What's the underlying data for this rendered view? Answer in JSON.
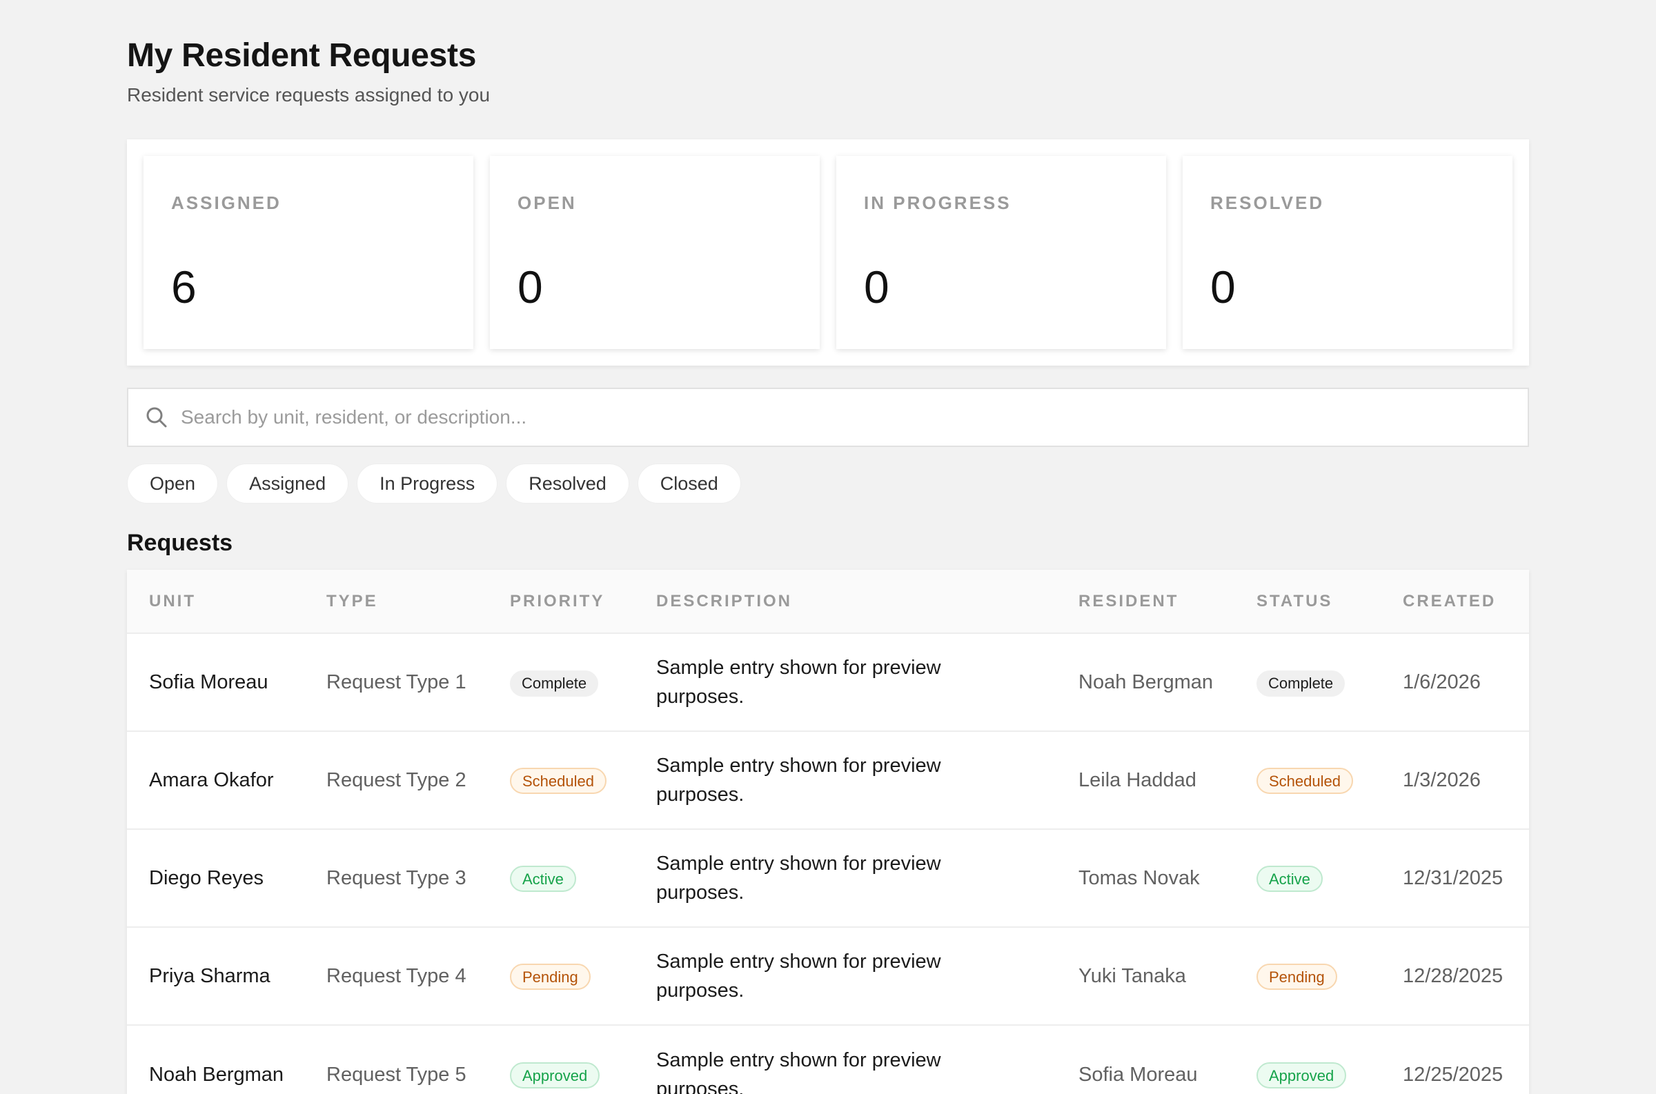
{
  "header": {
    "title": "My Resident Requests",
    "subtitle": "Resident service requests assigned to you"
  },
  "stats": [
    {
      "label": "ASSIGNED",
      "value": "6"
    },
    {
      "label": "OPEN",
      "value": "0"
    },
    {
      "label": "IN PROGRESS",
      "value": "0"
    },
    {
      "label": "RESOLVED",
      "value": "0"
    }
  ],
  "search": {
    "icon": "search-icon",
    "placeholder": "Search by unit, resident, or description...",
    "value": ""
  },
  "filters": [
    "Open",
    "Assigned",
    "In Progress",
    "Resolved",
    "Closed"
  ],
  "requests": {
    "title": "Requests",
    "columns": [
      "UNIT",
      "TYPE",
      "PRIORITY",
      "DESCRIPTION",
      "RESIDENT",
      "STATUS",
      "CREATED"
    ],
    "rows": [
      {
        "unit": "Sofia Moreau",
        "type": "Request Type 1",
        "priority": "Complete",
        "description": "Sample entry shown for preview purposes.",
        "resident": "Noah Bergman",
        "status": "Complete",
        "created": "1/6/2026"
      },
      {
        "unit": "Amara Okafor",
        "type": "Request Type 2",
        "priority": "Scheduled",
        "description": "Sample entry shown for preview purposes.",
        "resident": "Leila Haddad",
        "status": "Scheduled",
        "created": "1/3/2026"
      },
      {
        "unit": "Diego Reyes",
        "type": "Request Type 3",
        "priority": "Active",
        "description": "Sample entry shown for preview purposes.",
        "resident": "Tomas Novak",
        "status": "Active",
        "created": "12/31/2025"
      },
      {
        "unit": "Priya Sharma",
        "type": "Request Type 4",
        "priority": "Pending",
        "description": "Sample entry shown for preview purposes.",
        "resident": "Yuki Tanaka",
        "status": "Pending",
        "created": "12/28/2025"
      },
      {
        "unit": "Noah Bergman",
        "type": "Request Type 5",
        "priority": "Approved",
        "description": "Sample entry shown for preview purposes.",
        "resident": "Sofia Moreau",
        "status": "Approved",
        "created": "12/25/2025"
      }
    ]
  },
  "colors": {
    "background": "#f2f2f2",
    "card": "#ffffff",
    "muted_text": "#9a9a9a",
    "complete_badge": "#f0f0f0",
    "warning_text": "#b45309",
    "success_text": "#16a34a"
  }
}
